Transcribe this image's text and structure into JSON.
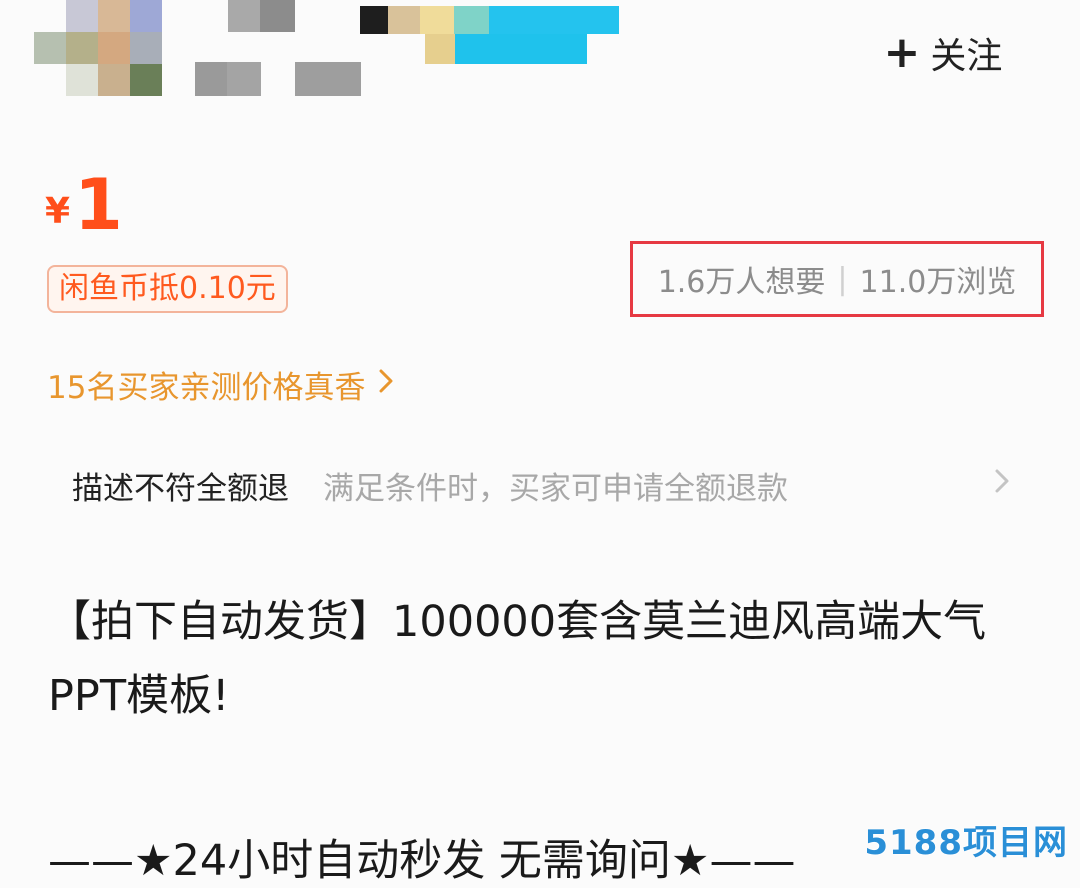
{
  "header": {
    "follow_label": "关注",
    "follow_icon": "plus-icon"
  },
  "price": {
    "currency": "¥",
    "amount": "1",
    "coin_discount": "闲鱼币抵0.10元"
  },
  "stats": {
    "wants": "1.6万人想要",
    "separator": "|",
    "views": "11.0万浏览"
  },
  "buyers_link": {
    "text": "15名买家亲测价格真香",
    "icon": "chevron-right-icon"
  },
  "guarantee": {
    "title": "描述不符全额退",
    "desc": "满足条件时，买家可申请全额退款",
    "icon": "chevron-right-icon"
  },
  "product": {
    "title": "【拍下自动发货】100000套含莫兰迪风高端大气PPT模板!",
    "line": "——★24小时自动秒发 无需询问★——"
  },
  "watermark": "5188项目网",
  "colors": {
    "price": "#ff4e1a",
    "highlight_box": "#e63942",
    "buyers_link": "#e8962e"
  }
}
